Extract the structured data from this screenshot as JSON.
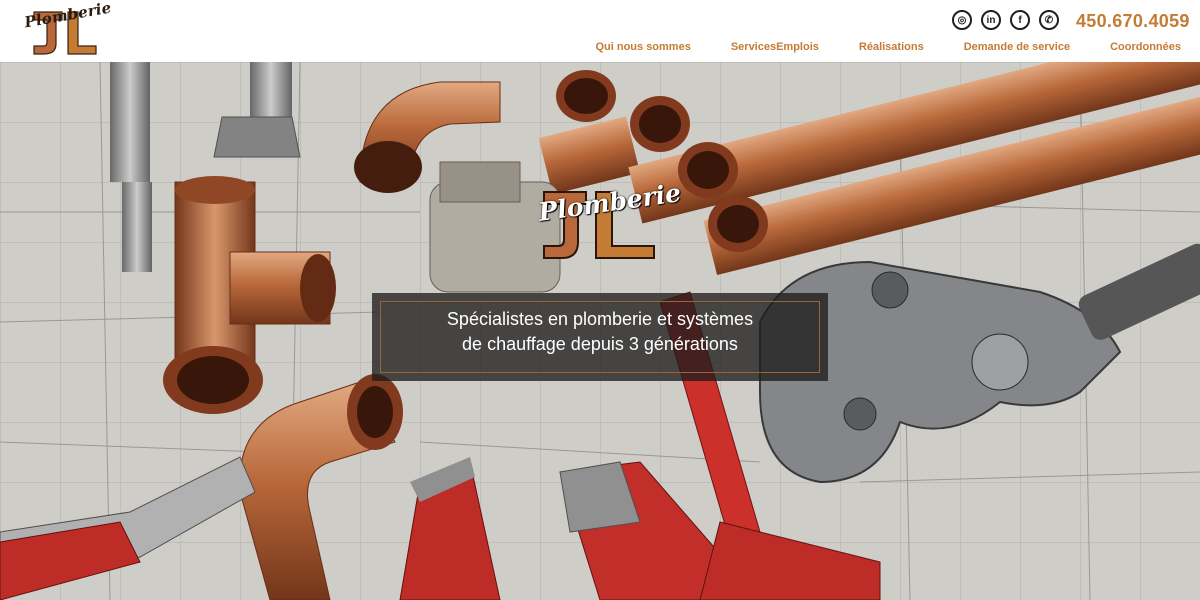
{
  "header": {
    "logo_text": "Plomberie",
    "phone": "450.670.4059",
    "social": [
      {
        "name": "instagram-icon",
        "glyph": "◎"
      },
      {
        "name": "linkedin-icon",
        "glyph": "in"
      },
      {
        "name": "facebook-icon",
        "glyph": "f"
      },
      {
        "name": "phone-icon",
        "glyph": "✆"
      }
    ],
    "nav": [
      {
        "label": "Qui nous sommes"
      },
      {
        "label": "ServicesEmplois"
      },
      {
        "label": "Réalisations"
      },
      {
        "label": "Demande de service"
      },
      {
        "label": "Coordonnées"
      }
    ]
  },
  "hero": {
    "logo_text": "Plomberie",
    "tagline_line1": "Spécialistes en plomberie et systèmes",
    "tagline_line2": "de chauffage depuis 3 générations"
  },
  "colors": {
    "accent": "#c47b34",
    "copper": "#b8683a",
    "dark": "#1f1f1f"
  }
}
